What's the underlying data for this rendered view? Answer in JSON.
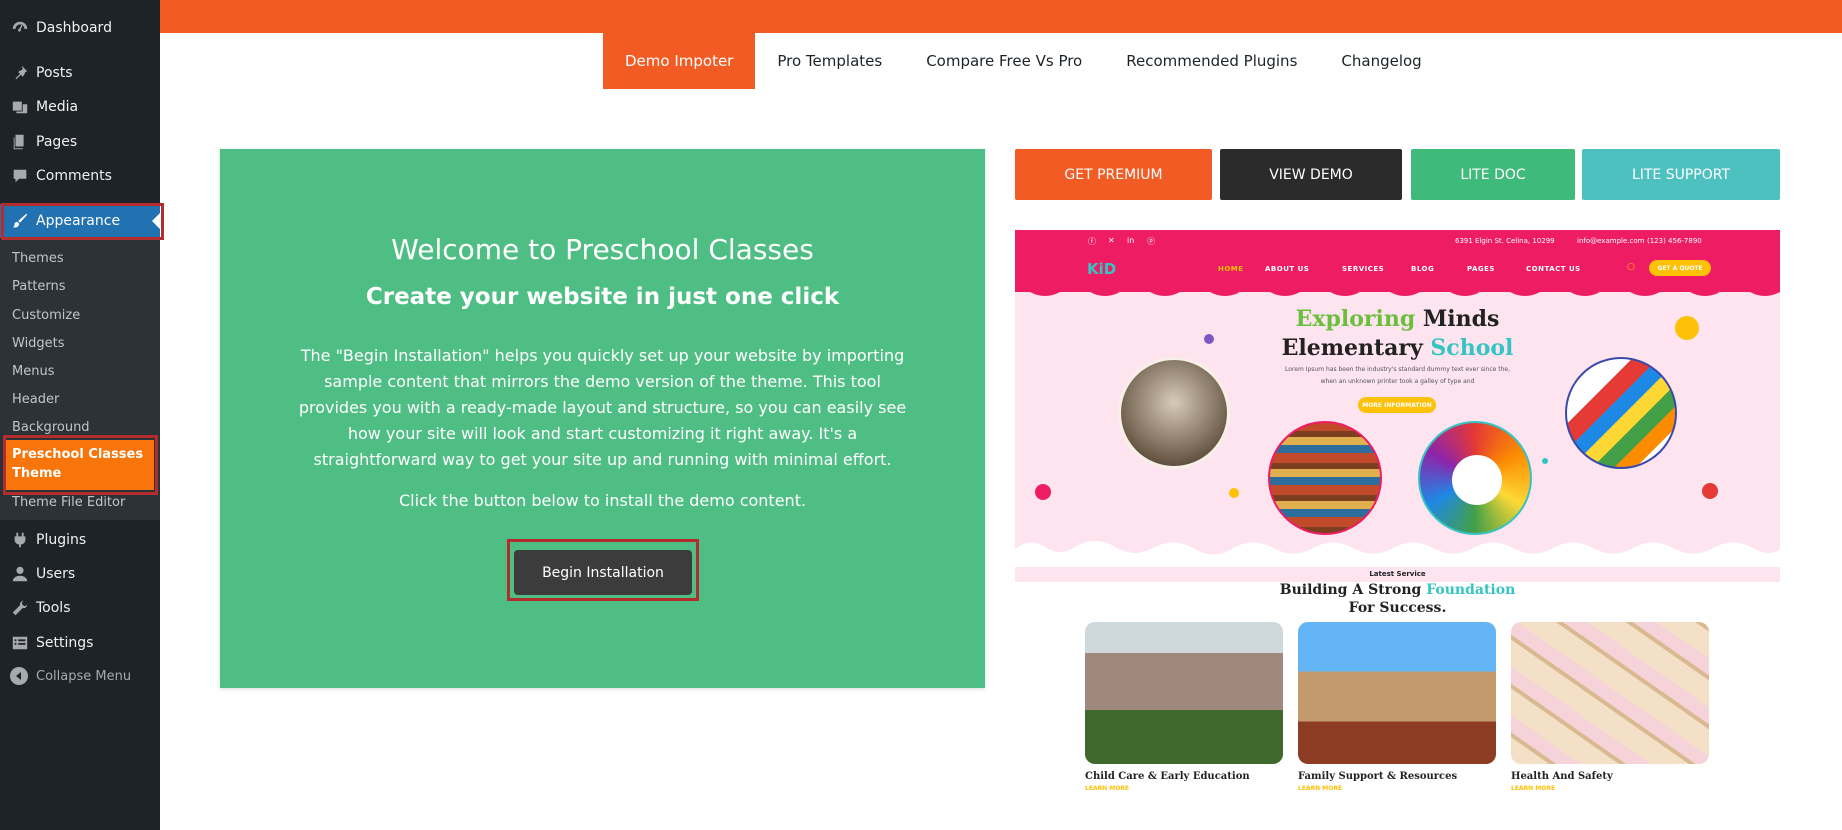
{
  "sidebar": {
    "items": [
      {
        "label": "Dashboard",
        "icon": "dashboard-icon"
      },
      {
        "label": "Posts",
        "icon": "pin-icon"
      },
      {
        "label": "Media",
        "icon": "media-icon"
      },
      {
        "label": "Pages",
        "icon": "pages-icon"
      },
      {
        "label": "Comments",
        "icon": "comment-icon"
      },
      {
        "label": "Appearance",
        "icon": "brush-icon"
      },
      {
        "label": "Plugins",
        "icon": "plugin-icon"
      },
      {
        "label": "Users",
        "icon": "user-icon"
      },
      {
        "label": "Tools",
        "icon": "wrench-icon"
      },
      {
        "label": "Settings",
        "icon": "settings-icon"
      }
    ],
    "submenu": [
      "Themes",
      "Patterns",
      "Customize",
      "Widgets",
      "Menus",
      "Header",
      "Background"
    ],
    "submenu_current": "Preschool Classes Theme",
    "submenu_after": "Theme File Editor",
    "collapse": "Collapse Menu"
  },
  "tabs": [
    "Demo Impoter",
    "Pro Templates",
    "Compare Free Vs Pro",
    "Recommended Plugins",
    "Changelog"
  ],
  "welcome": {
    "title": "Welcome to Preschool Classes",
    "subtitle": "Create your website in just one click",
    "description": "The \"Begin Installation\" helps you quickly set up your website by importing sample content that mirrors the demo version of the theme. This tool provides you with a ready-made layout and structure, so you can easily see how your site will look and start customizing it right away. It's a straightforward way to get your site up and running with minimal effort.",
    "click_text": "Click the button below to install the demo content.",
    "button": "Begin Installation"
  },
  "actions": [
    {
      "label": "GET PREMIUM",
      "color": "#f35b24"
    },
    {
      "label": "VIEW DEMO",
      "color": "#2b2b2b"
    },
    {
      "label": "LITE DOC",
      "color": "#3ebb7a"
    },
    {
      "label": "LITE SUPPORT",
      "color": "#4cc1c0"
    }
  ],
  "preview": {
    "address": "6391 Elgin St. Celina, 10299",
    "email": "info@example.com",
    "phone": "(123) 456-7890",
    "logo": "KiD",
    "nav": [
      "HOME",
      "ABOUT US",
      "SERVICES",
      "BLOG",
      "PAGES",
      "CONTACT US"
    ],
    "quote_btn": "GET A QUOTE",
    "hero_title_1a": "Exploring",
    "hero_title_1b": " Minds",
    "hero_title_2a": "Elementary ",
    "hero_title_2b": "School",
    "hero_lorem": "Lorem Ipsum has been the industry's standard dummy text ever since the, when an unknown printer took a galley of type and",
    "more_btn": "MORE INFORMATION",
    "latest": "Latest Service",
    "building_a": "Building A Strong ",
    "building_b": "Foundation",
    "building_c": "For Success.",
    "cards": [
      {
        "title": "Child Care & Early Education",
        "link": "LEARN MORE"
      },
      {
        "title": "Family Support & Resources",
        "link": "LEARN MORE"
      },
      {
        "title": "Health And Safety",
        "link": "LEARN MORE"
      }
    ]
  }
}
